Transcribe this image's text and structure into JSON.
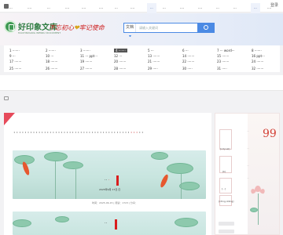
{
  "topbar": {
    "login": "登录"
  },
  "header": {
    "site_name": "好印象文库",
    "site_sub": "HAOYINXIANG WENKU DOCUMENT",
    "slogan_part1": "不忘初心",
    "slogan_part2": "牢记使命"
  },
  "search": {
    "selected": "文档",
    "placeholder": "请输入关键词"
  },
  "categories": [
    "1 ·······",
    "2 ·······",
    "3 ·······",
    "4 ·······",
    "5 ···",
    "6 ···",
    "7 ··· word···",
    "8 ·······",
    "9 ···",
    "10 ···",
    "11 ··· ppt···",
    "12 ···",
    "13 ·······",
    "14 ·······",
    "15 ·······",
    "16 ppt···",
    "17 ·······",
    "18 ·······",
    "19 ·······",
    "20 ·······",
    "21 ·······",
    "22 ·······",
    "23 ·······",
    "24 ·······",
    "25 ·······",
    "26 ·······",
    "27 ·······",
    "28 ·······",
    "29 ·····",
    "30 ·····",
    "31 ·····",
    "32 ·······"
  ],
  "nav": [
    "···",
    "····",
    "···",
    "····",
    "····",
    "····",
    "···",
    "····",
    "···",
    "···",
    "····",
    "····",
    "···",
    "···",
    "···",
    "····"
  ],
  "doc": {
    "title_main": "··········································",
    "title_red": "···",
    "title_tail": "··",
    "cover_title": "··",
    "cover_title_red": "·",
    "cover_date": "2025年6月 17日 日",
    "meta": "时间：2025-06-15 | 阅读：1723 | 分享：",
    "cover2_title": "··"
  },
  "sidebar": {
    "score": "99",
    "tag1": "[odyuel]",
    "tag2": "[b]",
    "tag3": "[···]",
    "tag4": "[rdlng,4ding]",
    "vtext": [
      "···",
      "···",
      "···",
      "···"
    ]
  },
  "colors": {
    "brand_green": "#2f7c42",
    "accent_blue": "#4b8ae4",
    "accent_red": "#d33f35"
  }
}
